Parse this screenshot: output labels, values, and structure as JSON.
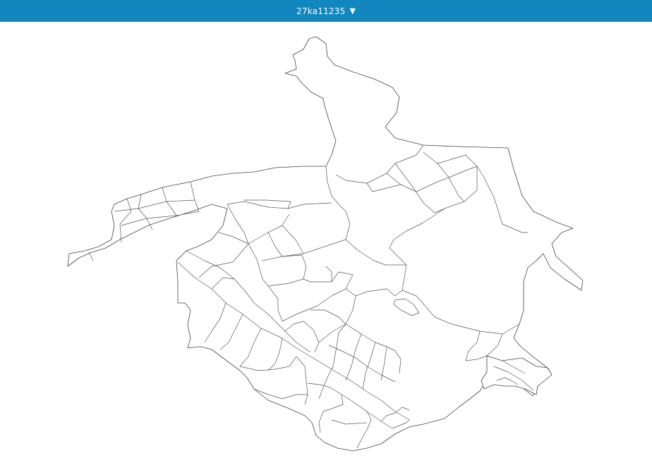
{
  "header": {
    "title": "27ka11235",
    "caret": "▼",
    "bg_color": "#1186bf"
  },
  "map": {
    "stroke_color": "#444444"
  }
}
